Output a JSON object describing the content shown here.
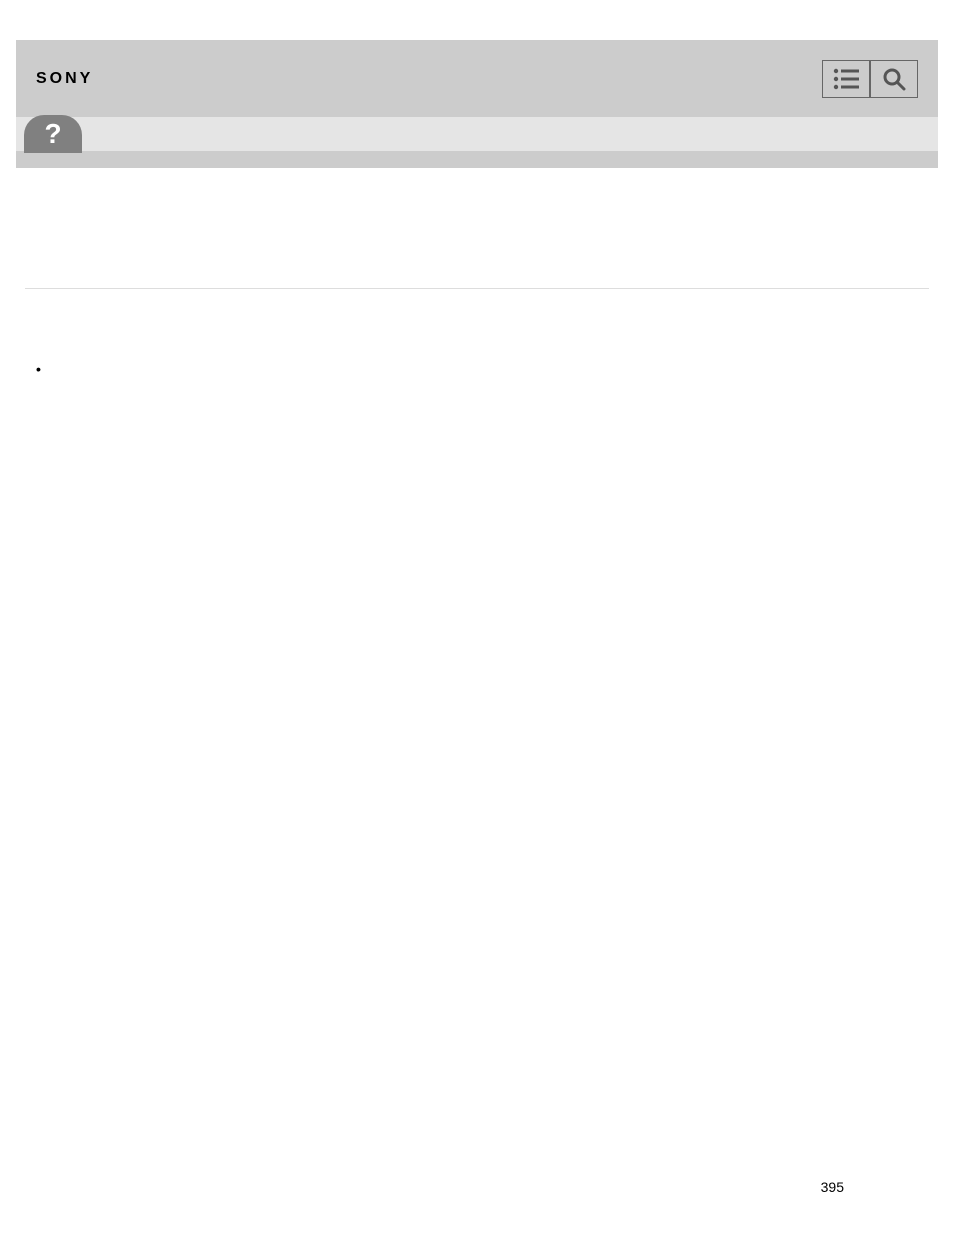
{
  "header": {
    "logo": "SONY"
  },
  "page": {
    "number": "395"
  }
}
